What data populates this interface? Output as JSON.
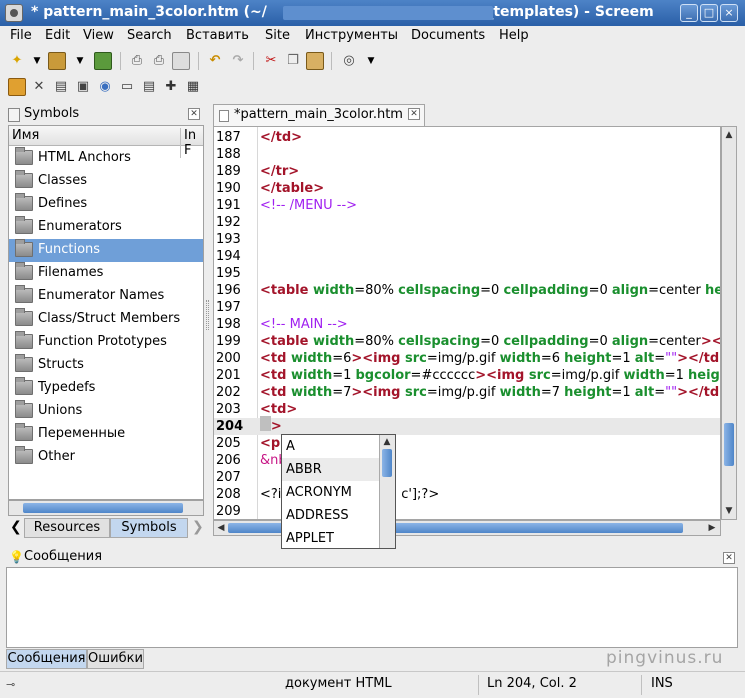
{
  "window": {
    "title": "* pattern_main_3color.htm (~/",
    "title_tail": "a_templates) - Screem",
    "controls": [
      "_",
      "□",
      "×"
    ]
  },
  "menu": [
    "File",
    "Edit",
    "View",
    "Search",
    "Вставить",
    "Site",
    "Инструменты",
    "Documents",
    "Help"
  ],
  "menu_underline": [
    "F",
    "E",
    "V",
    "S",
    "",
    "S",
    "",
    "D",
    "H"
  ],
  "symbols": {
    "title": "Symbols",
    "columns": [
      "Имя",
      "In F"
    ],
    "items": [
      "HTML Anchors",
      "Classes",
      "Defines",
      "Enumerators",
      "Functions",
      "Filenames",
      "Enumerator Names",
      "Class/Struct Members",
      "Function Prototypes",
      "Structs",
      "Typedefs",
      "Unions",
      "Переменные",
      "Other"
    ],
    "selected_index": 4
  },
  "left_tabs": [
    "Resources",
    "Symbols"
  ],
  "editor": {
    "tab_label": "*pattern_main_3color.htm",
    "current_line": 204
  },
  "code": [
    {
      "n": "187",
      "segs": [
        [
          "t",
          "</td>"
        ]
      ]
    },
    {
      "n": "188",
      "segs": []
    },
    {
      "n": "189",
      "segs": [
        [
          "t",
          "</tr>"
        ]
      ]
    },
    {
      "n": "190",
      "segs": [
        [
          "t",
          "</table>"
        ]
      ]
    },
    {
      "n": "191",
      "segs": [
        [
          "cm",
          "<!-- /MENU -->"
        ]
      ]
    },
    {
      "n": "192",
      "segs": []
    },
    {
      "n": "193",
      "segs": []
    },
    {
      "n": "194",
      "segs": []
    },
    {
      "n": "195",
      "segs": []
    },
    {
      "n": "196",
      "segs": [
        [
          "t",
          "<table "
        ],
        [
          "a",
          "width"
        ],
        [
          "v",
          "=80% "
        ],
        [
          "a",
          "cellspacing"
        ],
        [
          "v",
          "=0 "
        ],
        [
          "a",
          "cellpadding"
        ],
        [
          "v",
          "=0 "
        ],
        [
          "a",
          "align"
        ],
        [
          "v",
          "=center "
        ],
        [
          "a",
          "he"
        ]
      ]
    },
    {
      "n": "197",
      "segs": []
    },
    {
      "n": "198",
      "segs": [
        [
          "cm",
          "<!-- MAIN -->"
        ]
      ]
    },
    {
      "n": "199",
      "segs": [
        [
          "t",
          "<table "
        ],
        [
          "a",
          "width"
        ],
        [
          "v",
          "=80% "
        ],
        [
          "a",
          "cellspacing"
        ],
        [
          "v",
          "=0 "
        ],
        [
          "a",
          "cellpadding"
        ],
        [
          "v",
          "=0 "
        ],
        [
          "a",
          "align"
        ],
        [
          "v",
          "=center"
        ],
        [
          "t",
          "><"
        ]
      ]
    },
    {
      "n": "200",
      "segs": [
        [
          "t",
          "<td "
        ],
        [
          "a",
          "width"
        ],
        [
          "v",
          "=6"
        ],
        [
          "t",
          "><img "
        ],
        [
          "a",
          "src"
        ],
        [
          "v",
          "=img/p.gif "
        ],
        [
          "a",
          "width"
        ],
        [
          "v",
          "=6 "
        ],
        [
          "a",
          "height"
        ],
        [
          "v",
          "=1 "
        ],
        [
          "a",
          "alt"
        ],
        [
          "v",
          "="
        ],
        [
          "cm",
          "\"\""
        ],
        [
          "t",
          "></td>"
        ]
      ]
    },
    {
      "n": "201",
      "segs": [
        [
          "t",
          "<td "
        ],
        [
          "a",
          "width"
        ],
        [
          "v",
          "=1 "
        ],
        [
          "a",
          "bgcolor"
        ],
        [
          "v",
          "=#cccccc"
        ],
        [
          "t",
          "><img "
        ],
        [
          "a",
          "src"
        ],
        [
          "v",
          "=img/p.gif "
        ],
        [
          "a",
          "width"
        ],
        [
          "v",
          "=1 "
        ],
        [
          "a",
          "heigh"
        ]
      ]
    },
    {
      "n": "202",
      "segs": [
        [
          "t",
          "<td "
        ],
        [
          "a",
          "width"
        ],
        [
          "v",
          "=7"
        ],
        [
          "t",
          "><img "
        ],
        [
          "a",
          "src"
        ],
        [
          "v",
          "=img/p.gif "
        ],
        [
          "a",
          "width"
        ],
        [
          "v",
          "=7 "
        ],
        [
          "a",
          "height"
        ],
        [
          "v",
          "=1 "
        ],
        [
          "a",
          "alt"
        ],
        [
          "v",
          "="
        ],
        [
          "cm",
          "\"\""
        ],
        [
          "t",
          "></td>"
        ]
      ]
    },
    {
      "n": "203",
      "segs": [
        [
          "t",
          "<td>"
        ]
      ]
    },
    {
      "n": "204",
      "segs": [
        [
          "t",
          "<>"
        ]
      ]
    },
    {
      "n": "205",
      "segs": [
        [
          "t",
          "<p"
        ]
      ]
    },
    {
      "n": "206",
      "segs": [
        [
          "ent",
          "&nb"
        ]
      ]
    },
    {
      "n": "207",
      "segs": []
    },
    {
      "n": "208",
      "segs": [
        [
          "v",
          "<?i"
        ],
        [
          "v",
          "                             "
        ],
        [
          "v",
          "c'];?>"
        ]
      ]
    },
    {
      "n": "209",
      "segs": []
    }
  ],
  "autocomplete": {
    "items": [
      "A",
      "ABBR",
      "ACRONYM",
      "ADDRESS",
      "APPLET"
    ],
    "highlighted_index": 1
  },
  "messages": {
    "title": "Сообщения",
    "tabs": [
      "Сообщения",
      "Ошибки"
    ]
  },
  "watermark": "pingvinus.ru",
  "status": {
    "doc_type": "документ HTML",
    "position": "Ln 204, Col. 2",
    "mode": "INS"
  },
  "colors": {
    "titlebar": "#3a6db4",
    "selection": "#6f9fd8",
    "tag": "#a3142a",
    "attribute": "#1a8f2e",
    "comment": "#a020f0"
  },
  "icons": {
    "toolbar1": [
      "new-file-icon",
      "open-icon",
      "save-icon",
      "print-icon",
      "print-preview-icon",
      "undo-icon",
      "redo-icon",
      "cut-icon",
      "copy-icon",
      "paste-icon",
      "browser-preview-icon"
    ],
    "toolbar2": [
      "wizard-icon",
      "tag-tree-icon",
      "table-icon",
      "image-icon",
      "color-picker-icon",
      "form-icon",
      "link-icon",
      "insert-icon",
      "grid-icon"
    ]
  }
}
